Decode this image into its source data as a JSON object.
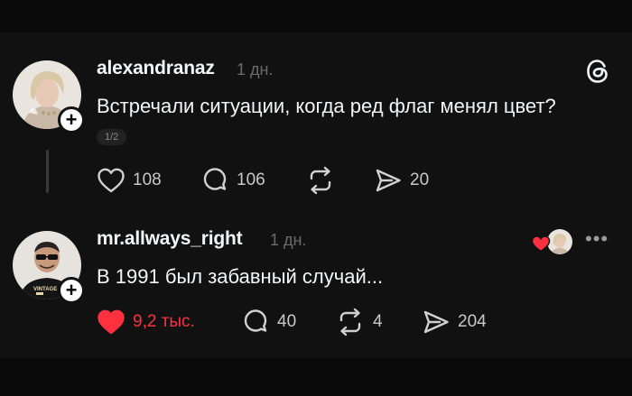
{
  "post": {
    "username": "alexandranaz",
    "time": "1 дн.",
    "text": "Встречали ситуации, когда ред флаг менял цвет?",
    "counter": "1/2",
    "actions": {
      "likes": "108",
      "replies": "106",
      "shares": "20"
    }
  },
  "reply": {
    "username": "mr.allways_right",
    "time": "1 дн.",
    "text": "В 1991 был забавный случай...",
    "actions": {
      "likes": "9,2 тыс.",
      "replies": "40",
      "reposts": "4",
      "shares": "204"
    }
  },
  "colors": {
    "like_active": "#ff3040",
    "background": "#111111",
    "muted": "#6b6b6b"
  },
  "icons": [
    "threads-logo-icon",
    "heart-icon",
    "comment-icon",
    "repost-icon",
    "share-icon",
    "more-icon",
    "plus-icon"
  ],
  "tshirt_print": "VINTAGE"
}
